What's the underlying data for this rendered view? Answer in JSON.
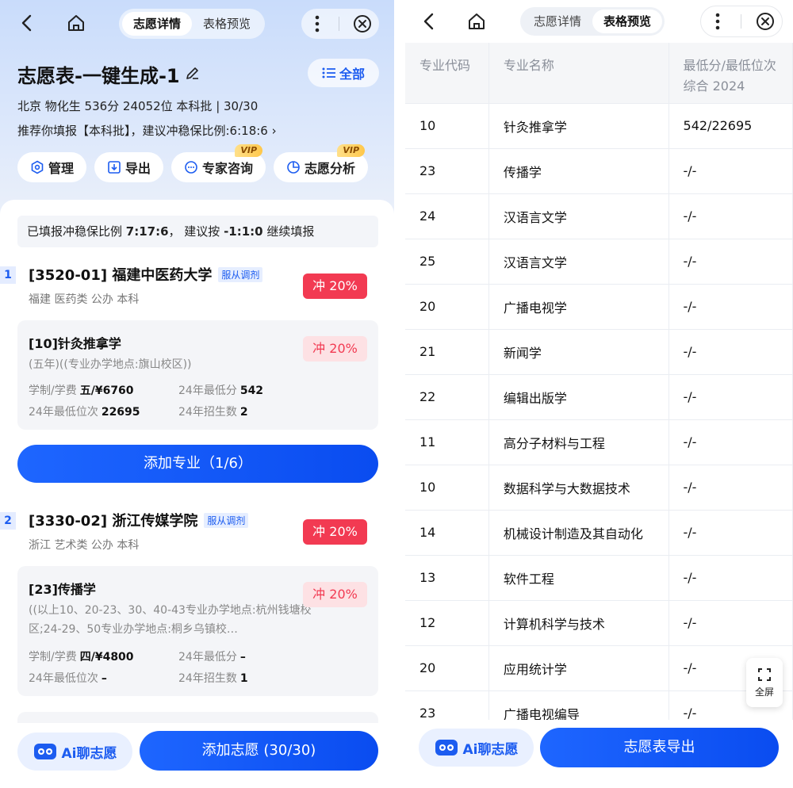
{
  "left": {
    "tabs": [
      "志愿详情",
      "表格预览"
    ],
    "title": "志愿表-一键生成-1",
    "all_button": "全部",
    "info_line1": "北京 物化生 536分 24052位 本科批 | 30/30",
    "info_line2": "推荐你填报【本科批】，建议冲稳保比例:6:18:6",
    "actions": [
      {
        "label": "管理",
        "icon": "manage-icon",
        "vip": ""
      },
      {
        "label": "导出",
        "icon": "export-icon",
        "vip": ""
      },
      {
        "label": "专家咨询",
        "icon": "chat-icon",
        "vip": "VIP"
      },
      {
        "label": "志愿分析",
        "icon": "pie-icon",
        "vip": "VIP"
      }
    ],
    "ratio_prefix": "已填报冲稳保比例 ",
    "ratio_value": "7:17:6",
    "ratio_mid": "， 建议按 ",
    "ratio_suggest": "-1:1:0",
    "ratio_suffix": " 继续填报",
    "schools": [
      {
        "index": "1",
        "name": "[3520-01] 福建中医药大学",
        "tag": "服从调剂",
        "meta": "福建  医药类  公办  本科",
        "chance": "冲 20%",
        "major": {
          "name": "[10]针灸推拿学",
          "note": "(五年)((专业办学地点:旗山校区))",
          "chance": "冲 20%",
          "k1": "学制/学费",
          "v1": "五/¥6760",
          "k2": "24年最低分",
          "v2": "542",
          "k3": "24年最低位次",
          "v3": "22695",
          "k4": "24年招生数",
          "v4": "2"
        }
      },
      {
        "index": "2",
        "name": "[3330-02] 浙江传媒学院",
        "tag": "服从调剂",
        "meta": "浙江  艺术类  公办  本科",
        "chance": "冲 20%",
        "major": {
          "name": "[23]传播学",
          "note": "((以上10、20-23、30、40-43专业办学地点:杭州钱塘校区;24-29、50专业办学地点:桐乡乌镇校…",
          "chance": "冲 20%",
          "k1": "学制/学费",
          "v1": "四/¥4800",
          "k2": "24年最低分",
          "v2": "–",
          "k3": "24年最低位次",
          "v3": "–",
          "k4": "24年招生数",
          "v4": "1"
        }
      }
    ],
    "add_major": "添加专业（1/6）",
    "ai_label": "Ai聊志愿",
    "add_choice": "添加志愿 (30/30)"
  },
  "right": {
    "tabs": [
      "志愿详情",
      "表格预览"
    ],
    "headers": [
      "专业代码",
      "专业名称",
      "最低分/最低位次 综合 2024"
    ],
    "rows": [
      [
        "10",
        "针灸推拿学",
        "542/22695"
      ],
      [
        "23",
        "传播学",
        "-/-"
      ],
      [
        "24",
        "汉语言文学",
        "-/-"
      ],
      [
        "25",
        "汉语言文学",
        "-/-"
      ],
      [
        "20",
        "广播电视学",
        "-/-"
      ],
      [
        "21",
        "新闻学",
        "-/-"
      ],
      [
        "22",
        "编辑出版学",
        "-/-"
      ],
      [
        "11",
        "高分子材料与工程",
        "-/-"
      ],
      [
        "10",
        "数据科学与大数据技术",
        "-/-"
      ],
      [
        "14",
        "机械设计制造及其自动化",
        "-/-"
      ],
      [
        "13",
        "软件工程",
        "-/-"
      ],
      [
        "12",
        "计算机科学与技术",
        "-/-"
      ],
      [
        "20",
        "应用统计学",
        "-/-"
      ],
      [
        "23",
        "广播电视编导",
        "-/-"
      ]
    ],
    "fullscreen": "全屏",
    "ai_label": "Ai聊志愿",
    "export": "志愿表导出"
  },
  "colors": {
    "accent": "#1c5cf0",
    "chong_red": "#f23a52"
  }
}
